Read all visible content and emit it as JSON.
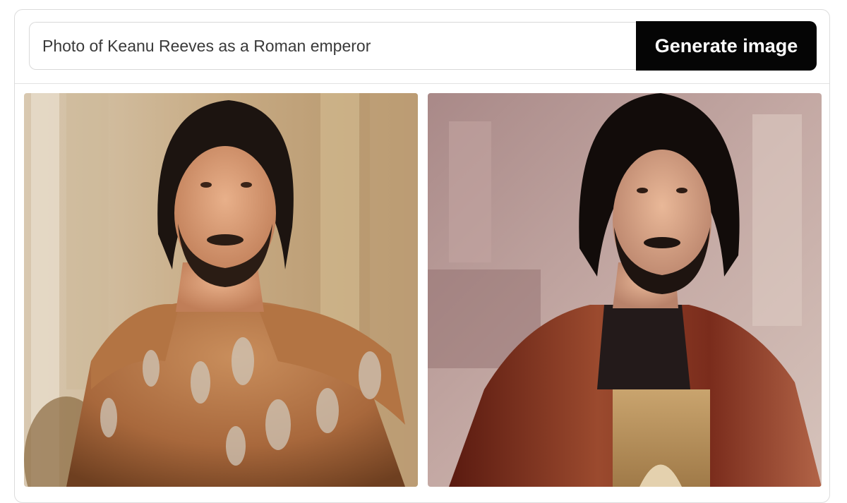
{
  "prompt": {
    "value": "Photo of Keanu Reeves as a Roman emperor"
  },
  "generate_button": {
    "label": "Generate image"
  },
  "images": [
    {
      "subject": "man with long dark hair and beard in bronze Roman armor",
      "palette": "warm bronze"
    },
    {
      "subject": "man with long dark hair and beard in dark red robe with gold chest plate",
      "palette": "maroon and gold"
    }
  ]
}
